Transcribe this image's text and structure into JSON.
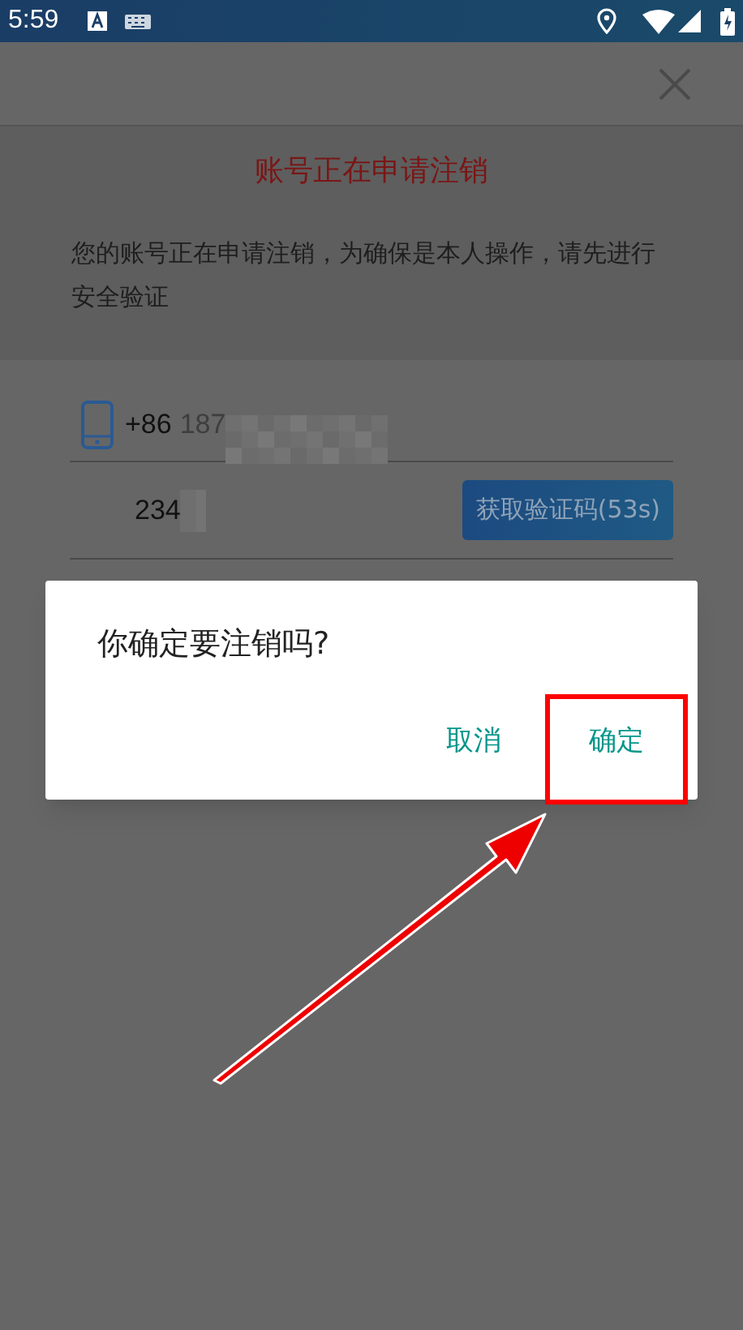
{
  "status_bar": {
    "time": "5:59"
  },
  "notice": {
    "title": "账号正在申请注销",
    "text": "您的账号正在申请注销，为确保是本人操作，请先进行安全验证"
  },
  "phone_field": {
    "country_code": "+86",
    "value": "187"
  },
  "code_field": {
    "value": "234"
  },
  "code_button": {
    "label": "获取验证码(53s)"
  },
  "dialog": {
    "message": "你确定要注销吗?",
    "buttons": [
      {
        "label": "取消",
        "highlighted": false
      },
      {
        "label": "确定",
        "highlighted": true
      }
    ]
  }
}
